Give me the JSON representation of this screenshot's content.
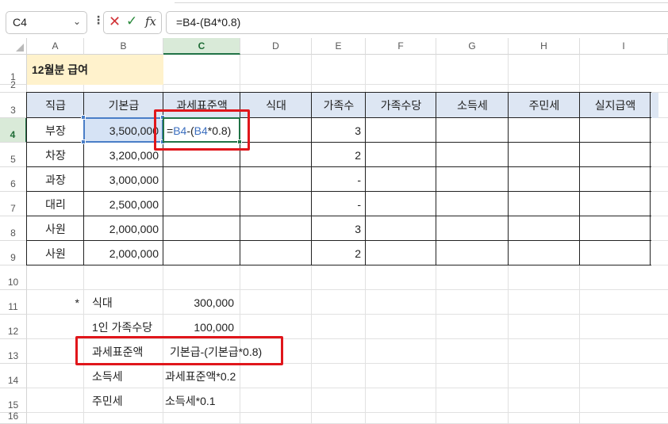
{
  "formula_bar": {
    "name_box": "C4",
    "name_box_arrow": "⌄",
    "more": "⋮",
    "cancel": "✕",
    "enter": "✓",
    "fx": "fx",
    "formula": "=B4-(B4*0.8)"
  },
  "columns": [
    "A",
    "B",
    "C",
    "D",
    "E",
    "F",
    "G",
    "H",
    "I"
  ],
  "active_column": "C",
  "rows": [
    "1",
    "2",
    "3",
    "4",
    "5",
    "6",
    "7",
    "8",
    "9",
    "10",
    "11",
    "12",
    "13",
    "14",
    "15",
    "16"
  ],
  "active_row": "4",
  "title": "12월분 급여",
  "table": {
    "headers": [
      "직급",
      "기본급",
      "과세표준액",
      "식대",
      "가족수",
      "가족수당",
      "소득세",
      "주민세",
      "실지급액"
    ],
    "rows": [
      {
        "rank": "부장",
        "base": "3,500,000",
        "family": "3"
      },
      {
        "rank": "차장",
        "base": "3,200,000",
        "family": "2"
      },
      {
        "rank": "과장",
        "base": "3,000,000",
        "family": "-"
      },
      {
        "rank": "대리",
        "base": "2,500,000",
        "family": "-"
      },
      {
        "rank": "사원",
        "base": "2,000,000",
        "family": "3"
      },
      {
        "rank": "사원",
        "base": "2,000,000",
        "family": "2"
      }
    ],
    "edit_cell": {
      "prefix": "=",
      "ref1": "B4",
      "mid": "-(",
      "ref2": "B4",
      "suffix": "*0.8)"
    }
  },
  "notes": {
    "asterisk": "*",
    "meal_label": "식대",
    "meal_value": "300,000",
    "family_label": "1인 가족수당",
    "family_value": "100,000",
    "taxbase_label": "과세표준액",
    "taxbase_formula": "기본급-(기본급*0.8)",
    "income_tax_label": "소득세",
    "income_tax_formula": "과세표준액*0.2",
    "resident_tax_label": "주민세",
    "resident_tax_formula": "소득세*0.1"
  },
  "colors": {
    "accent_green": "#217346",
    "highlight_red": "#e0161b",
    "title_fill": "#fff2cc",
    "header_fill": "#dde6f3",
    "reference_blue": "#3d6fbf"
  }
}
